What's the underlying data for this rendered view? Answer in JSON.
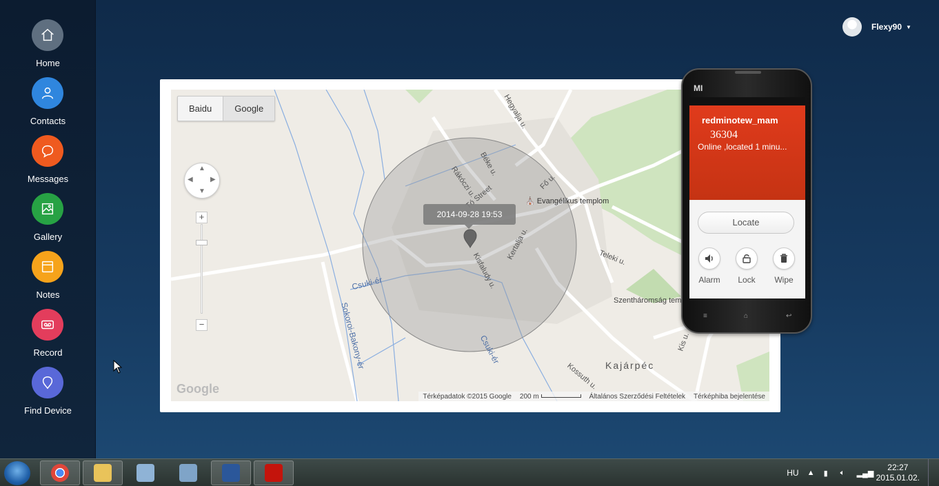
{
  "sidebar": {
    "items": [
      {
        "label": "Home",
        "icon": "home-icon",
        "color": "#5f6f80"
      },
      {
        "label": "Contacts",
        "icon": "person-icon",
        "color": "#2f86de"
      },
      {
        "label": "Messages",
        "icon": "chat-bubble-icon",
        "color": "#ef5a1f"
      },
      {
        "label": "Gallery",
        "icon": "image-icon",
        "color": "#27a244"
      },
      {
        "label": "Notes",
        "icon": "note-icon",
        "color": "#f6a31b"
      },
      {
        "label": "Record",
        "icon": "cassette-icon",
        "color": "#e33d5c"
      },
      {
        "label": "Find Device",
        "icon": "location-pin-icon",
        "color": "#5968d8"
      }
    ]
  },
  "user": {
    "name": "Flexy90"
  },
  "map": {
    "providers": [
      "Baidu",
      "Google"
    ],
    "selected_provider": "Google",
    "timestamp": "2014-09-28 19:53",
    "labels": {
      "tostreet": "Tó Street",
      "rakoczi": "Rákóczi u.",
      "beke": "Béke u.",
      "hegyalja": "Hegyalja u.",
      "fou": "Fő u.",
      "church": "Evangélikus templom",
      "kertalja": "Kertalja u.",
      "kisfaludy": "Kisfaludy u.",
      "teleki": "Teleki u.",
      "csukier1": "Csuki-ér",
      "csukier2": "Csuki-ér",
      "sokoroi": "Sokoroi-Bakony-ér",
      "szentharomsag": "Szentháromság tem",
      "kajarpec": "Kajárpéc",
      "kossuth": "Kossuth u.",
      "kis": "Kis u."
    },
    "google_logo": "Google",
    "footer": {
      "copyright": "Térképadatok ©2015 Google",
      "scale": "200 m",
      "terms": "Általános Szerződési Feltételek",
      "report": "Térképhiba bejelentése"
    }
  },
  "phone": {
    "brand": "MI",
    "device_name": "redminotew_mam",
    "device_id": "36304",
    "status": "Online ,located 1 minu...",
    "locate_label": "Locate",
    "actions": [
      {
        "label": "Alarm",
        "icon": "speaker-icon"
      },
      {
        "label": "Lock",
        "icon": "lock-icon"
      },
      {
        "label": "Wipe",
        "icon": "trash-icon"
      }
    ]
  },
  "taskbar": {
    "apps": [
      {
        "name": "chrome-icon",
        "color": "#e0463a"
      },
      {
        "name": "file-explorer-icon",
        "color": "#e9c35a"
      },
      {
        "name": "calculator-icon",
        "color": "#8fb3d6"
      },
      {
        "name": "network-icon",
        "color": "#7fa4c8"
      },
      {
        "name": "word-icon",
        "color": "#2b579a"
      },
      {
        "name": "acrobat-icon",
        "color": "#c4140c"
      }
    ],
    "language": "HU",
    "time": "22:27",
    "date": "2015.01.02."
  }
}
